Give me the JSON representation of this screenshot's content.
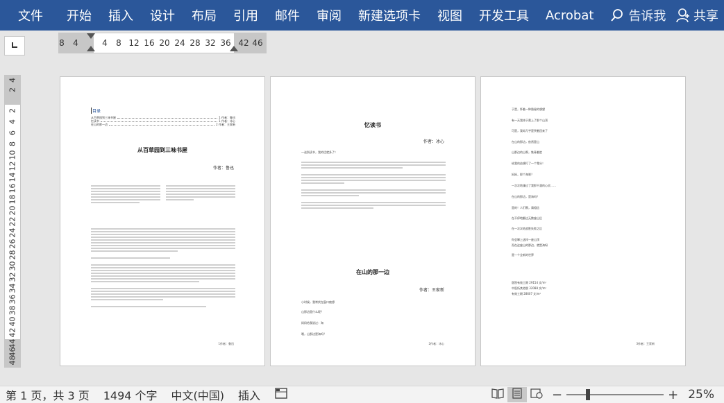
{
  "ribbon": {
    "tabs": [
      "文件",
      "开始",
      "插入",
      "设计",
      "布局",
      "引用",
      "邮件",
      "审阅",
      "新建选项卡",
      "视图",
      "开发工具",
      "Acrobat"
    ],
    "tell_me": "告诉我",
    "share": "共享",
    "color": "#2b579a"
  },
  "hruler": {
    "ticks": [
      "8",
      "4",
      "4",
      "8",
      "12",
      "16",
      "20",
      "24",
      "28",
      "32",
      "36",
      "42",
      "46"
    ]
  },
  "vruler": {
    "ticks": [
      "4",
      "2",
      "2",
      "4",
      "6",
      "8",
      "10",
      "12",
      "14",
      "16",
      "18",
      "20",
      "22",
      "24",
      "26",
      "28",
      "30",
      "32",
      "34",
      "36",
      "38",
      "40",
      "42",
      "44",
      "46",
      "48"
    ]
  },
  "page1": {
    "toc_title": "目录",
    "toc": [
      {
        "text": "从百草园到三味书屋",
        "ref": "1 作者：鲁迅"
      },
      {
        "text": "忆读书",
        "ref": "1 作者：冰心"
      },
      {
        "text": "在山的那一边",
        "ref": "2 作者：王家新"
      }
    ],
    "title": "从百草园到三味书屋",
    "author": "作者：鲁迅",
    "footer": "1作者：鲁迅"
  },
  "page2": {
    "title1": "忆读书",
    "author1": "作者：冰心",
    "intro": "一谈到读书，我的话就多了！",
    "title2": "在山的那一边",
    "author2": "作者：王家新",
    "poem": [
      "小时候，我常伏在窗口痴想",
      "山那边是什么呢？",
      "妈妈给我说过：海",
      "哦，山那边是海吗？"
    ],
    "footer": "2作者：冰心"
  },
  "page3": {
    "lines": [
      "于是，怀着一种隐秘的想望",
      "有一天我终于爬上了那个山顶",
      "可是，我却几乎是哭着回来了",
      "在山的那边，依然是山",
      "山那边的山啊，铁青着脸",
      "给我的幼想打了一个零分！",
      "妈妈，那个海呢？",
      "一次次地漫过了我那干涸的心灵……",
      "在山的那边，是海吗？",
      "是的！人们啊，请相信",
      "在不停地翻过无数座山后",
      "在一次次地战胜失败之后",
      "你会攀上这样一座山顶",
      "而在这座山的那边，就是海呀",
      "是一个全新的世界"
    ],
    "stats": [
      "医院有效工期 29154 文/m²",
      "中医所其他税 32088 文/m²",
      "有效工期 28607 文/m²"
    ],
    "footer": "3作者：王家新"
  },
  "status": {
    "page": "第 1 页，共 3 页",
    "words": "1494 个字",
    "lang": "中文(中国)",
    "mode": "插入",
    "zoom_minus": "−",
    "zoom_plus": "+",
    "zoom": "25%"
  }
}
